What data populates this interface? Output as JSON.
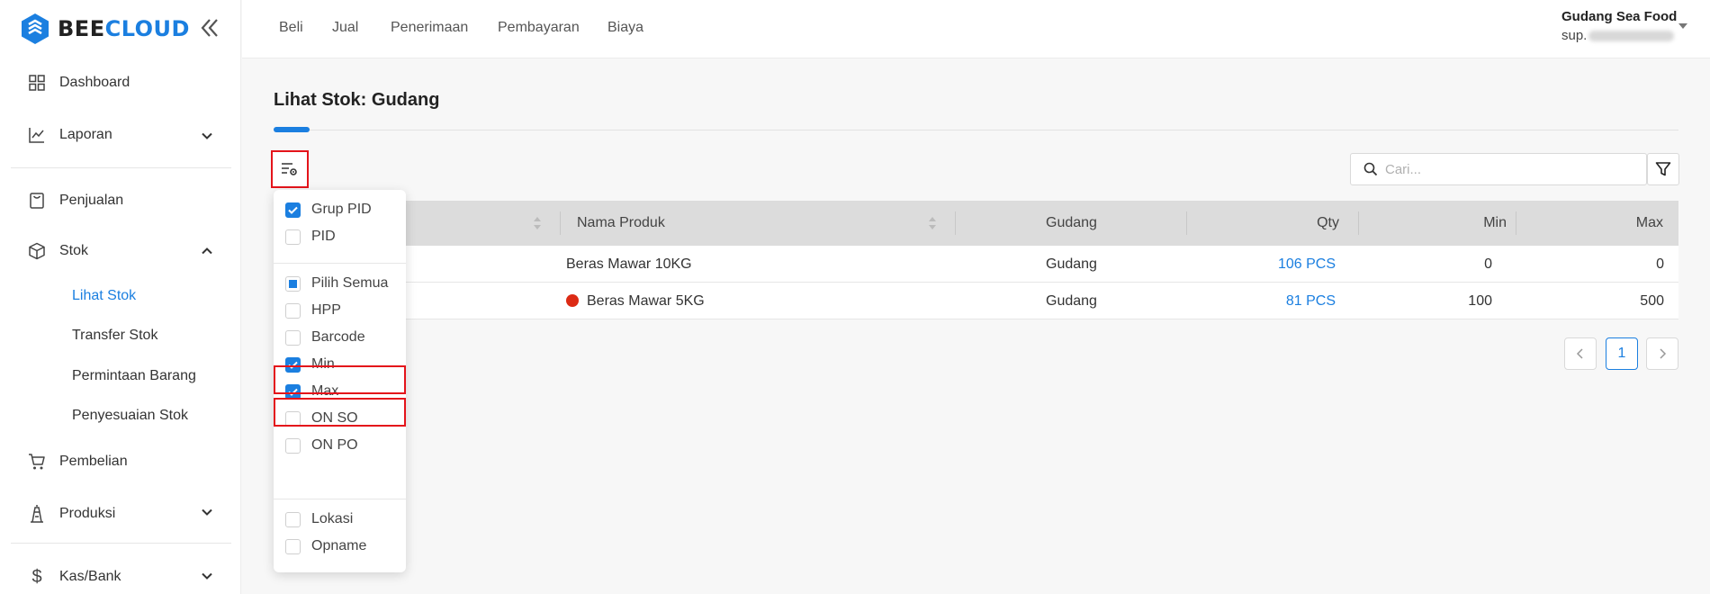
{
  "brand": {
    "part1": "BEE",
    "part2": "CLOUD"
  },
  "sidebar": {
    "items": [
      {
        "label": "Dashboard",
        "icon": "dashboard-grid-icon"
      },
      {
        "label": "Laporan",
        "icon": "chart-line-icon"
      },
      {
        "label": "Penjualan",
        "icon": "receipt-icon"
      },
      {
        "label": "Stok",
        "icon": "box-icon"
      },
      {
        "label": "Pembelian",
        "icon": "cart-icon"
      },
      {
        "label": "Produksi",
        "icon": "factory-icon"
      },
      {
        "label": "Kas/Bank",
        "icon": "dollar-icon"
      }
    ],
    "stok_sub": [
      "Lihat Stok",
      "Transfer Stok",
      "Permintaan Barang",
      "Penyesuaian Stok"
    ]
  },
  "topnav": [
    "Beli",
    "Jual",
    "Penerimaan",
    "Pembayaran",
    "Biaya"
  ],
  "user": {
    "name": "Gudang Sea Food",
    "email_prefix": "sup."
  },
  "page": {
    "title": "Lihat Stok: Gudang"
  },
  "search": {
    "placeholder": "Cari..."
  },
  "table": {
    "headers": [
      "Nama Produk",
      "Gudang",
      "Qty",
      "Min",
      "Max"
    ],
    "rows": [
      {
        "nama": "Beras Mawar 10KG",
        "gudang": "Gudang",
        "qty": "106 PCS",
        "min": "0",
        "max": "0",
        "dot": false
      },
      {
        "nama": "Beras Mawar 5KG",
        "gudang": "Gudang",
        "qty": "81 PCS",
        "min": "100",
        "max": "500",
        "dot": true
      }
    ]
  },
  "pagination": {
    "current": "1"
  },
  "column_menu": {
    "options": [
      {
        "label": "Grup PID",
        "state": "checked"
      },
      {
        "label": "PID",
        "state": "unchecked"
      },
      {
        "label": "Pilih Semua",
        "state": "partial"
      },
      {
        "label": "HPP",
        "state": "unchecked"
      },
      {
        "label": "Barcode",
        "state": "unchecked"
      },
      {
        "label": "Min",
        "state": "checked"
      },
      {
        "label": "Max",
        "state": "checked"
      },
      {
        "label": "ON SO",
        "state": "unchecked"
      },
      {
        "label": "ON PO",
        "state": "unchecked"
      },
      {
        "label": "Lokasi",
        "state": "unchecked"
      },
      {
        "label": "Opname",
        "state": "unchecked"
      }
    ]
  },
  "colors": {
    "accent": "#1b7fe0",
    "highlight": "#e4141b",
    "danger_dot": "#dc2a14"
  }
}
